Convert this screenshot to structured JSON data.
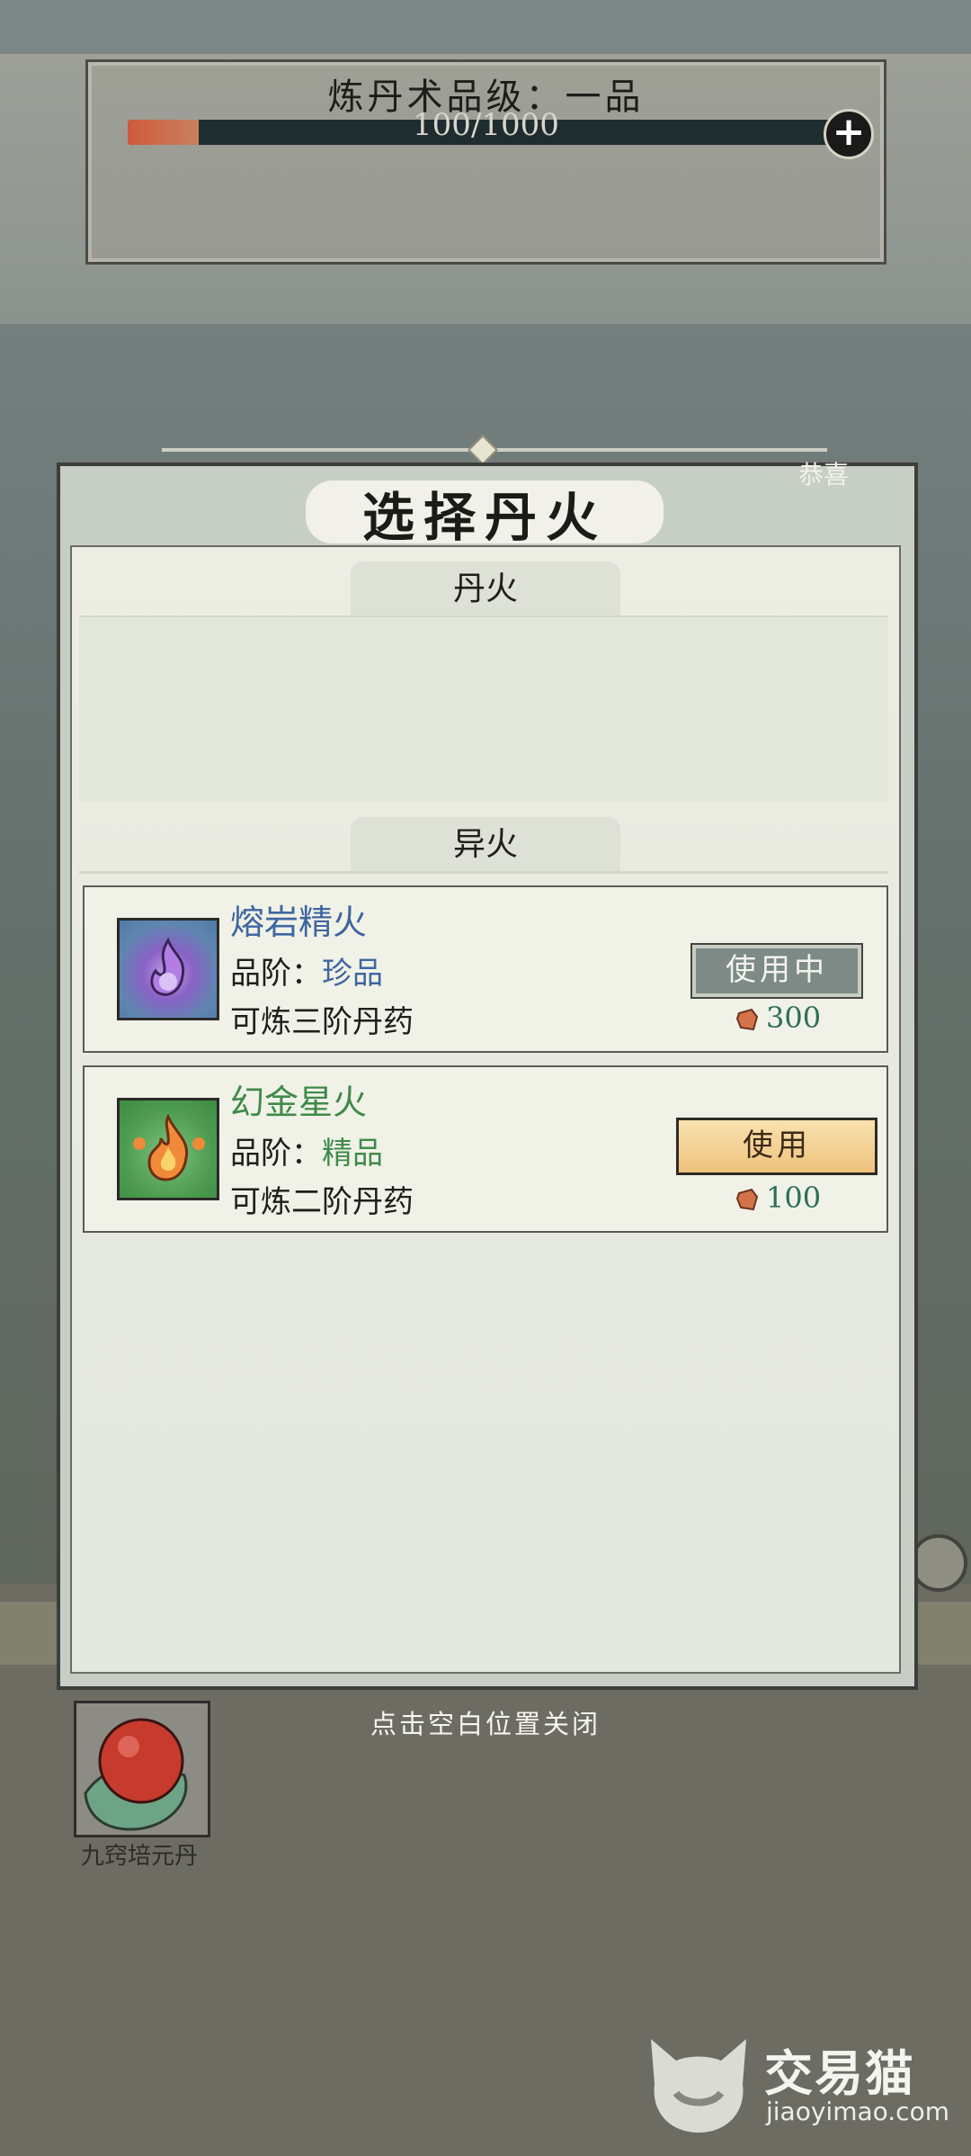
{
  "header": {
    "grade_title": "炼丹术品级：一品",
    "progress_text": "100/1000",
    "progress": 0.1,
    "add_icon": "plus-icon"
  },
  "modal": {
    "corner_text": "恭喜",
    "title": "选择丹火",
    "sections": {
      "dan_fire": "丹火",
      "strange_fire": "异火"
    },
    "fires": [
      {
        "name": "熔岩精火",
        "grade_label": "品阶：",
        "grade": "珍品",
        "desc": "可炼三阶丹药",
        "status": "使用中",
        "cost": "300",
        "name_color": "#3f66a0",
        "grade_color": "#3f66a0",
        "icon": "purple-flame-icon"
      },
      {
        "name": "幻金星火",
        "grade_label": "品阶：",
        "grade": "精品",
        "desc": "可炼二阶丹药",
        "status": "使用",
        "cost": "100",
        "name_color": "#3f8a4a",
        "grade_color": "#3f8a4a",
        "icon": "orange-flame-icon"
      }
    ]
  },
  "footer": {
    "close_hint": "点击空白位置关闭",
    "item_name": "九窍培元丹",
    "item_icon": "red-pill-icon"
  },
  "watermark": {
    "title": "交易猫",
    "url": "jiaoyimao.com"
  }
}
